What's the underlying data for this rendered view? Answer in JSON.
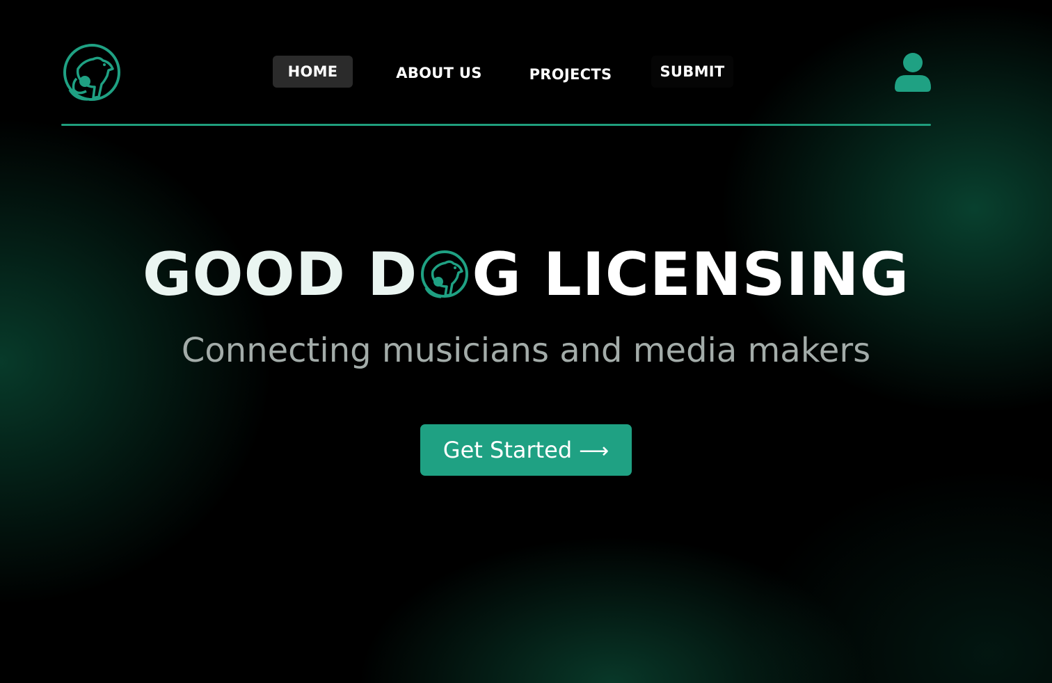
{
  "brand": {
    "logo_icon": "dog-headphones-logo",
    "accent_color": "#1fa183"
  },
  "nav": {
    "items": [
      {
        "label": "HOME",
        "active": true
      },
      {
        "label": "ABOUT US",
        "active": false
      },
      {
        "label": "PROJECTS",
        "active": false
      },
      {
        "label": "SUBMIT",
        "active": false
      }
    ],
    "user_icon": "user-icon"
  },
  "hero": {
    "title_part1": "GOOD D",
    "title_part2": "G LICENSING",
    "subtitle": "Connecting musicians and media makers",
    "cta_label": "Get Started",
    "cta_arrow": "⟶"
  }
}
